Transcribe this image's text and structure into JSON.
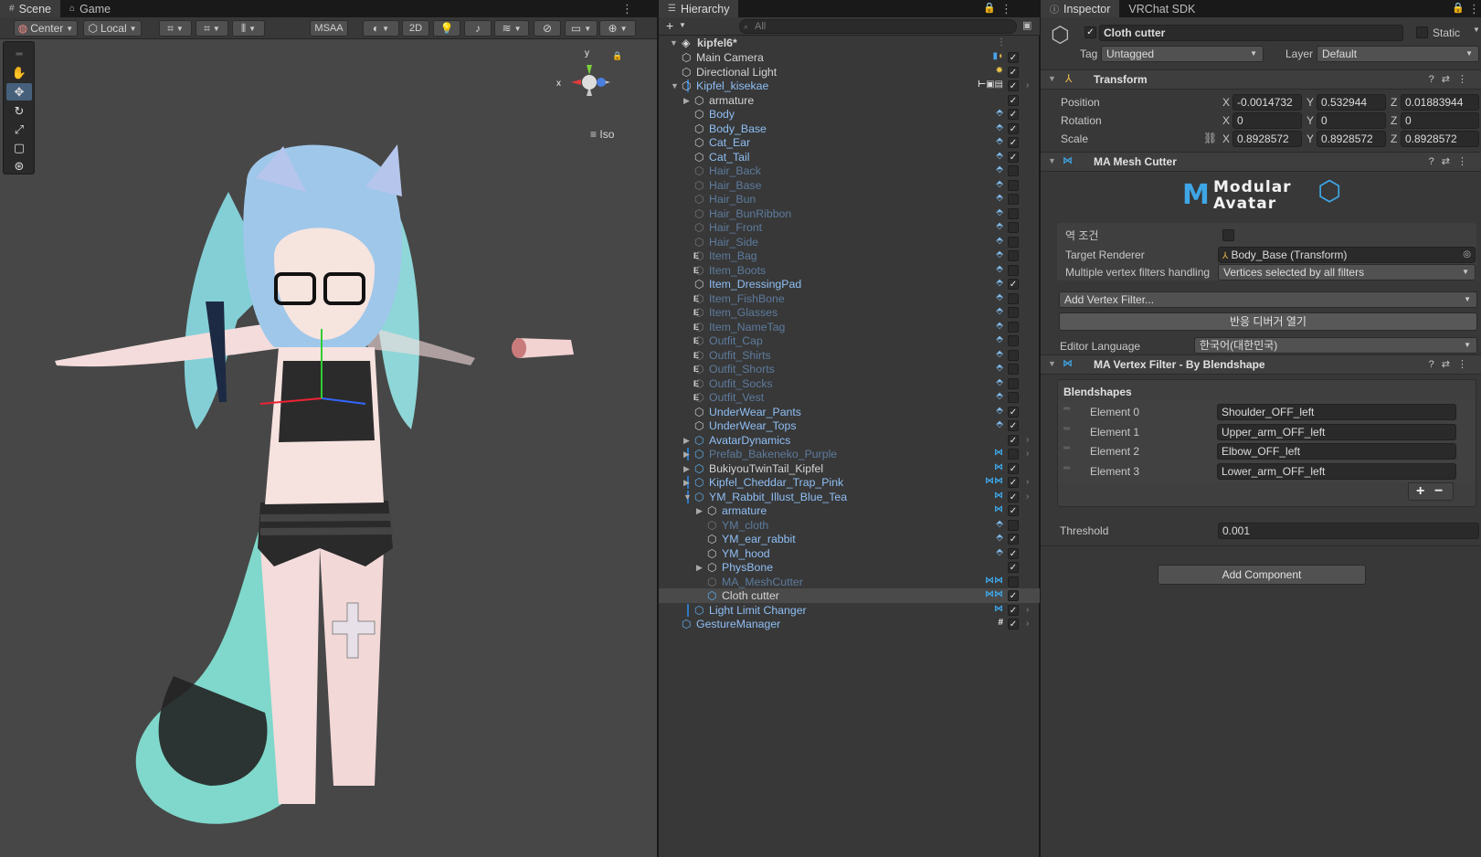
{
  "scene_panel": {
    "tabs": [
      {
        "label": "Scene",
        "icon": "hash-icon"
      },
      {
        "label": "Game",
        "icon": "gamepad-icon"
      }
    ],
    "toolbar": {
      "pivot_mode": "Center",
      "pivot_rotation": "Local",
      "msaa": "MSAA",
      "mode_2d": "2D"
    },
    "gizmo": {
      "y_label": "y",
      "x_label": "x",
      "projection": "Iso"
    }
  },
  "hierarchy": {
    "tab_label": "Hierarchy",
    "search_placeholder": "All",
    "scene_name": "kipfel6*",
    "rows": [
      {
        "label": "Main Camera",
        "indent": 1,
        "color": "white",
        "checked": true,
        "icons": "cam-audio"
      },
      {
        "label": "Directional Light",
        "indent": 1,
        "color": "white",
        "checked": true,
        "icons": "light"
      },
      {
        "label": "Kipfel_kisekae",
        "indent": 1,
        "color": "blue",
        "checked": true,
        "icons": "prefab",
        "expanded": true,
        "bar": true,
        "chevron": true
      },
      {
        "label": "armature",
        "indent": 2,
        "color": "white",
        "checked": true,
        "collapsed": true
      },
      {
        "label": "Body",
        "indent": 2,
        "color": "blue",
        "checked": true,
        "icons": "mesh"
      },
      {
        "label": "Body_Base",
        "indent": 2,
        "color": "blue",
        "checked": true,
        "icons": "mesh"
      },
      {
        "label": "Cat_Ear",
        "indent": 2,
        "color": "blue",
        "checked": true,
        "icons": "mesh"
      },
      {
        "label": "Cat_Tail",
        "indent": 2,
        "color": "blue",
        "checked": true,
        "icons": "mesh"
      },
      {
        "label": "Hair_Back",
        "indent": 2,
        "color": "faint",
        "checked": false,
        "icons": "mesh"
      },
      {
        "label": "Hair_Base",
        "indent": 2,
        "color": "faint",
        "checked": false,
        "icons": "mesh"
      },
      {
        "label": "Hair_Bun",
        "indent": 2,
        "color": "faint",
        "checked": false,
        "icons": "mesh"
      },
      {
        "label": "Hair_BunRibbon",
        "indent": 2,
        "color": "faint",
        "checked": false,
        "icons": "mesh"
      },
      {
        "label": "Hair_Front",
        "indent": 2,
        "color": "faint",
        "checked": false,
        "icons": "mesh"
      },
      {
        "label": "Hair_Side",
        "indent": 2,
        "color": "faint",
        "checked": false,
        "icons": "mesh"
      },
      {
        "label": "Item_Bag",
        "indent": 2,
        "color": "faint",
        "checked": false,
        "icons": "mesh",
        "eflag": "E"
      },
      {
        "label": "Item_Boots",
        "indent": 2,
        "color": "faint",
        "checked": false,
        "icons": "mesh",
        "eflag": "E"
      },
      {
        "label": "Item_DressingPad",
        "indent": 2,
        "color": "blue",
        "checked": true,
        "icons": "mesh"
      },
      {
        "label": "Item_FishBone",
        "indent": 2,
        "color": "faint",
        "checked": false,
        "icons": "mesh",
        "eflag": "E"
      },
      {
        "label": "Item_Glasses",
        "indent": 2,
        "color": "faint",
        "checked": false,
        "icons": "mesh",
        "eflag": "E"
      },
      {
        "label": "Item_NameTag",
        "indent": 2,
        "color": "faint",
        "checked": false,
        "icons": "mesh",
        "eflag": "E"
      },
      {
        "label": "Outfit_Cap",
        "indent": 2,
        "color": "faint",
        "checked": false,
        "icons": "mesh",
        "eflag": "E"
      },
      {
        "label": "Outfit_Shirts",
        "indent": 2,
        "color": "faint",
        "checked": false,
        "icons": "mesh",
        "eflag": "E"
      },
      {
        "label": "Outfit_Shorts",
        "indent": 2,
        "color": "faint",
        "checked": false,
        "icons": "mesh",
        "eflag": "E"
      },
      {
        "label": "Outfit_Socks",
        "indent": 2,
        "color": "faint",
        "checked": false,
        "icons": "mesh",
        "eflag": "E"
      },
      {
        "label": "Outfit_Vest",
        "indent": 2,
        "color": "faint",
        "checked": false,
        "icons": "mesh",
        "eflag": "E"
      },
      {
        "label": "UnderWear_Pants",
        "indent": 2,
        "color": "blue",
        "checked": true,
        "icons": "mesh"
      },
      {
        "label": "UnderWear_Tops",
        "indent": 2,
        "color": "blue",
        "checked": true,
        "icons": "mesh"
      },
      {
        "label": "AvatarDynamics",
        "indent": 2,
        "color": "blue",
        "checked": true,
        "collapsed": true,
        "prefab": true,
        "chevron": true
      },
      {
        "label": "Prefab_Bakeneko_Purple",
        "indent": 2,
        "color": "faint",
        "checked": false,
        "collapsed": true,
        "prefab": true,
        "icons": "ma",
        "chevron": true,
        "bar": true
      },
      {
        "label": "BukiyouTwinTail_Kipfel",
        "indent": 2,
        "color": "white",
        "checked": true,
        "collapsed": true,
        "prefab": true,
        "icons": "ma"
      },
      {
        "label": "Kipfel_Cheddar_Trap_Pink",
        "indent": 2,
        "color": "blue",
        "checked": true,
        "collapsed": true,
        "prefab": true,
        "icons": "ma-multi",
        "chevron": true,
        "bar": true
      },
      {
        "label": "YM_Rabbit_Illust_Blue_Tea",
        "indent": 2,
        "color": "blue",
        "checked": true,
        "expanded": true,
        "prefab": true,
        "icons": "ma",
        "chevron": true,
        "bar": true
      },
      {
        "label": "armature",
        "indent": 3,
        "color": "blue",
        "checked": true,
        "collapsed": true,
        "icons": "ma"
      },
      {
        "label": "YM_cloth",
        "indent": 3,
        "color": "faint",
        "checked": false,
        "icons": "mesh"
      },
      {
        "label": "YM_ear_rabbit",
        "indent": 3,
        "color": "blue",
        "checked": true,
        "icons": "mesh"
      },
      {
        "label": "YM_hood",
        "indent": 3,
        "color": "blue",
        "checked": true,
        "icons": "mesh"
      },
      {
        "label": "PhysBone",
        "indent": 3,
        "color": "blue",
        "checked": true,
        "collapsed": true
      },
      {
        "label": "MA_MeshCutter",
        "indent": 3,
        "color": "faint",
        "checked": false,
        "icons": "ma-multi"
      },
      {
        "label": "Cloth cutter",
        "indent": 3,
        "color": "white",
        "checked": true,
        "icons": "ma-multi",
        "selected": true,
        "prefab": true
      },
      {
        "label": "Light Limit Changer",
        "indent": 2,
        "color": "blue",
        "checked": true,
        "prefab": true,
        "icons": "ma",
        "chevron": true,
        "bar": true
      },
      {
        "label": "GestureManager",
        "indent": 1,
        "color": "blue",
        "checked": true,
        "prefab": true,
        "icons": "hash",
        "chevron": true
      }
    ]
  },
  "inspector": {
    "tabs": [
      {
        "label": "Inspector",
        "icon": "info-icon"
      },
      {
        "label": "VRChat SDK"
      }
    ],
    "object_name": "Cloth cutter",
    "static_label": "Static",
    "tag_label": "Tag",
    "tag_value": "Untagged",
    "layer_label": "Layer",
    "layer_value": "Default",
    "transform": {
      "title": "Transform",
      "position_label": "Position",
      "rotation_label": "Rotation",
      "scale_label": "Scale",
      "position": {
        "x": "-0.0014732",
        "y": "0.532944",
        "z": "0.01883944"
      },
      "rotation": {
        "x": "0",
        "y": "0",
        "z": "0"
      },
      "scale": {
        "x": "0.8928572",
        "y": "0.8928572",
        "z": "0.8928572"
      },
      "axis_x": "X",
      "axis_y": "Y",
      "axis_z": "Z"
    },
    "mesh_cutter": {
      "title": "MA Mesh Cutter",
      "logo_text": "Modular Avatar",
      "invert_label": "역 조건",
      "target_renderer_label": "Target Renderer",
      "target_renderer_value": "Body_Base (Transform)",
      "multi_filter_label": "Multiple vertex filters handling",
      "multi_filter_value": "Vertices selected by all filters",
      "add_filter_label": "Add Vertex Filter...",
      "debugger_button": "반응 디버거 열기",
      "editor_language_label": "Editor Language",
      "editor_language_value": "한국어(대한민국)"
    },
    "vertex_filter": {
      "title": "MA Vertex Filter - By Blendshape",
      "list_title": "Blendshapes",
      "elements": [
        {
          "label": "Element 0",
          "value": "Shoulder_OFF_left"
        },
        {
          "label": "Element 1",
          "value": "Upper_arm_OFF_left"
        },
        {
          "label": "Element 2",
          "value": "Elbow_OFF_left"
        },
        {
          "label": "Element 3",
          "value": "Lower_arm_OFF_left"
        }
      ],
      "plus": "+",
      "minus": "−",
      "threshold_label": "Threshold",
      "threshold_value": "0.001"
    },
    "add_component_label": "Add Component"
  },
  "colors": {
    "selection": "#46607c",
    "prefab_blue": "#8fbff5",
    "disabled_blue": "#5d7b9e",
    "ma_blue": "#3ea6e6"
  }
}
